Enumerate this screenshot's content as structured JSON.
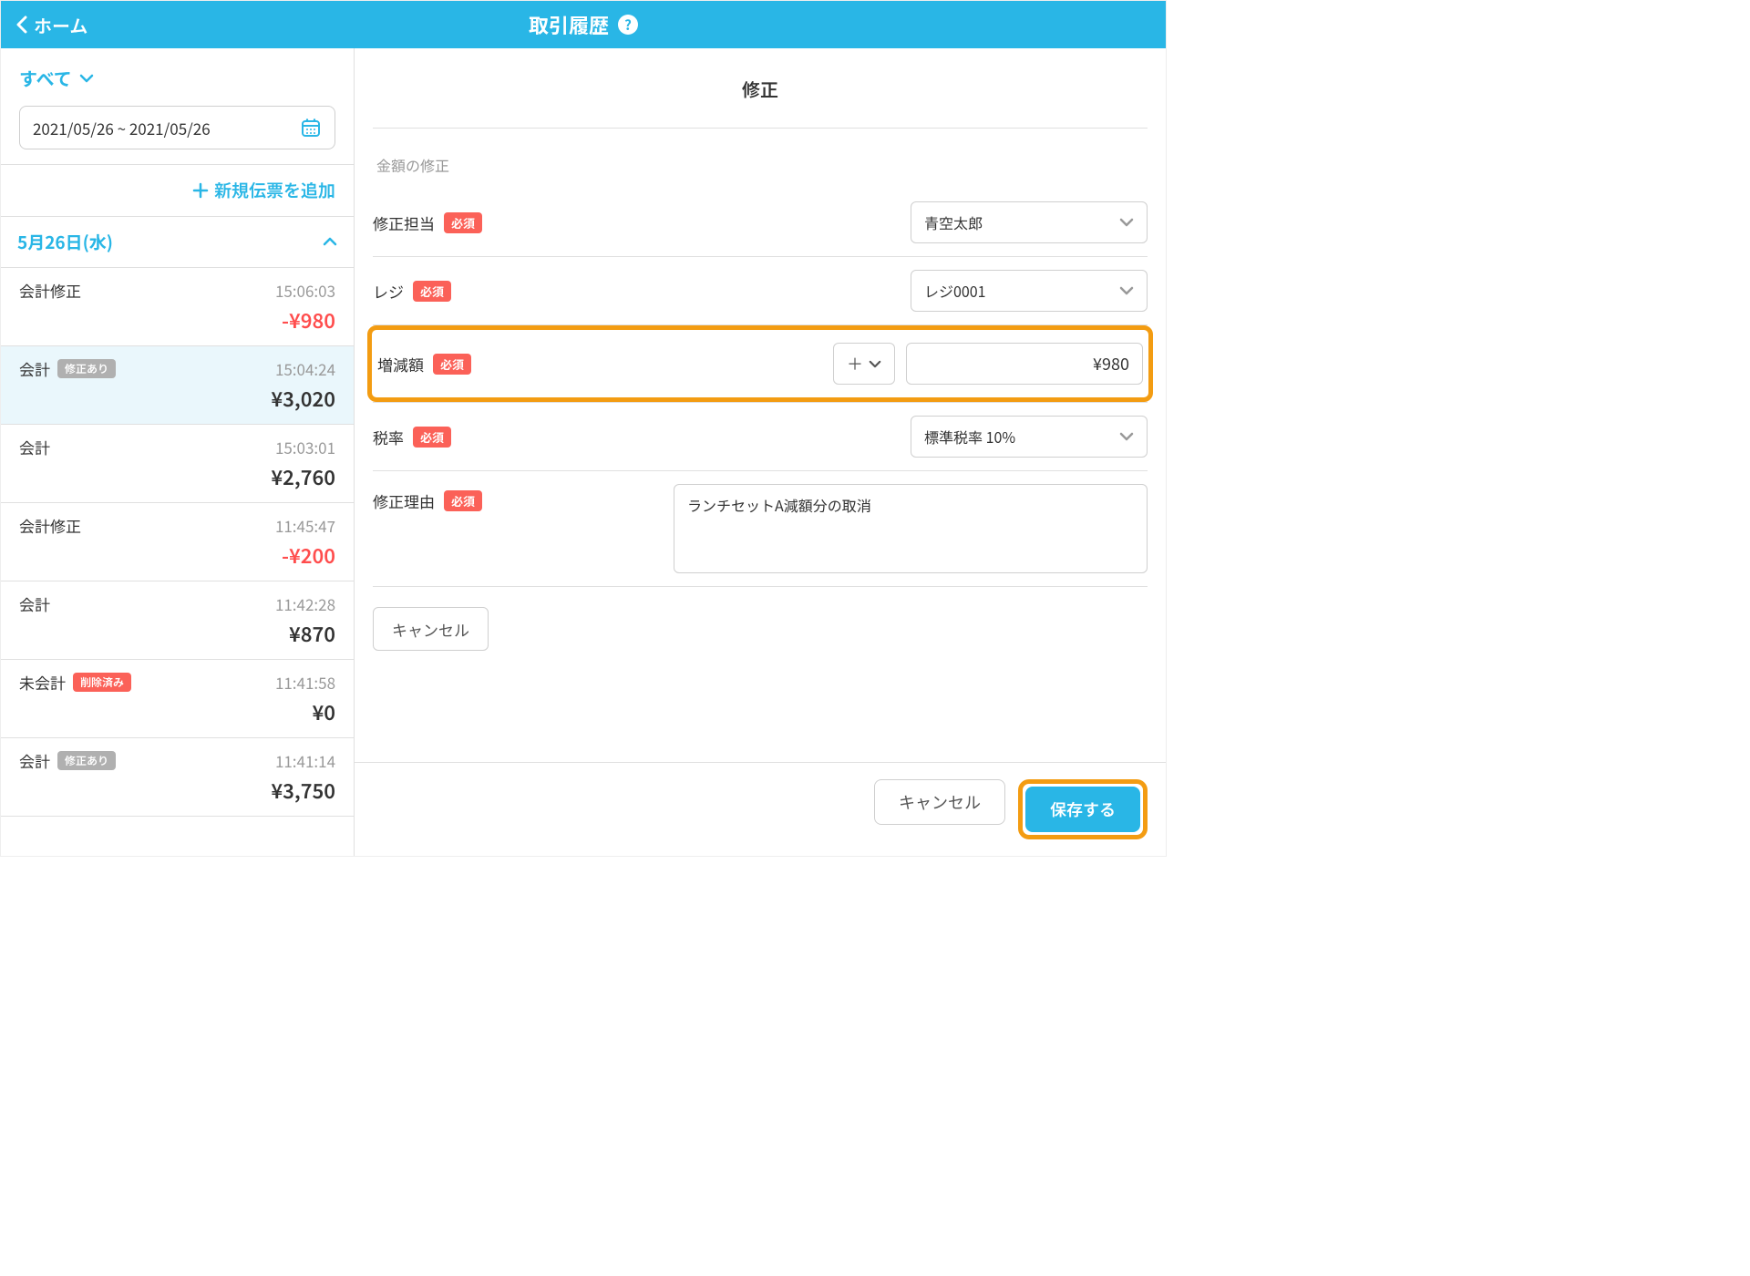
{
  "header": {
    "home": "ホーム",
    "title": "取引履歴"
  },
  "sidebar": {
    "filter": "すべて",
    "date_range": "2021/05/26 ~ 2021/05/26",
    "add_slip": "新規伝票を追加",
    "group_date": "5月26日(水)",
    "badges": {
      "edited": "修正あり",
      "deleted": "削除済み"
    },
    "items": [
      {
        "title": "会計修正",
        "time": "15:06:03",
        "amount": "-¥980",
        "neg": true,
        "badge": null,
        "selected": false
      },
      {
        "title": "会計",
        "time": "15:04:24",
        "amount": "¥3,020",
        "neg": false,
        "badge": "edited",
        "selected": true
      },
      {
        "title": "会計",
        "time": "15:03:01",
        "amount": "¥2,760",
        "neg": false,
        "badge": null,
        "selected": false
      },
      {
        "title": "会計修正",
        "time": "11:45:47",
        "amount": "-¥200",
        "neg": true,
        "badge": null,
        "selected": false
      },
      {
        "title": "会計",
        "time": "11:42:28",
        "amount": "¥870",
        "neg": false,
        "badge": null,
        "selected": false
      },
      {
        "title": "未会計",
        "time": "11:41:58",
        "amount": "¥0",
        "neg": false,
        "badge": "deleted",
        "selected": false
      },
      {
        "title": "会計",
        "time": "11:41:14",
        "amount": "¥3,750",
        "neg": false,
        "badge": "edited",
        "selected": false
      }
    ]
  },
  "form": {
    "title": "修正",
    "section": "金額の修正",
    "labels": {
      "staff": "修正担当",
      "register": "レジ",
      "amount": "増減額",
      "tax": "税率",
      "reason": "修正理由",
      "required": "必須"
    },
    "values": {
      "staff": "青空太郎",
      "register": "レジ0001",
      "sign": "＋",
      "amount": "¥980",
      "tax": "標準税率 10%",
      "reason": "ランチセットA減額分の取消"
    },
    "cancel_inline": "キャンセル"
  },
  "footer": {
    "cancel": "キャンセル",
    "save": "保存する"
  }
}
